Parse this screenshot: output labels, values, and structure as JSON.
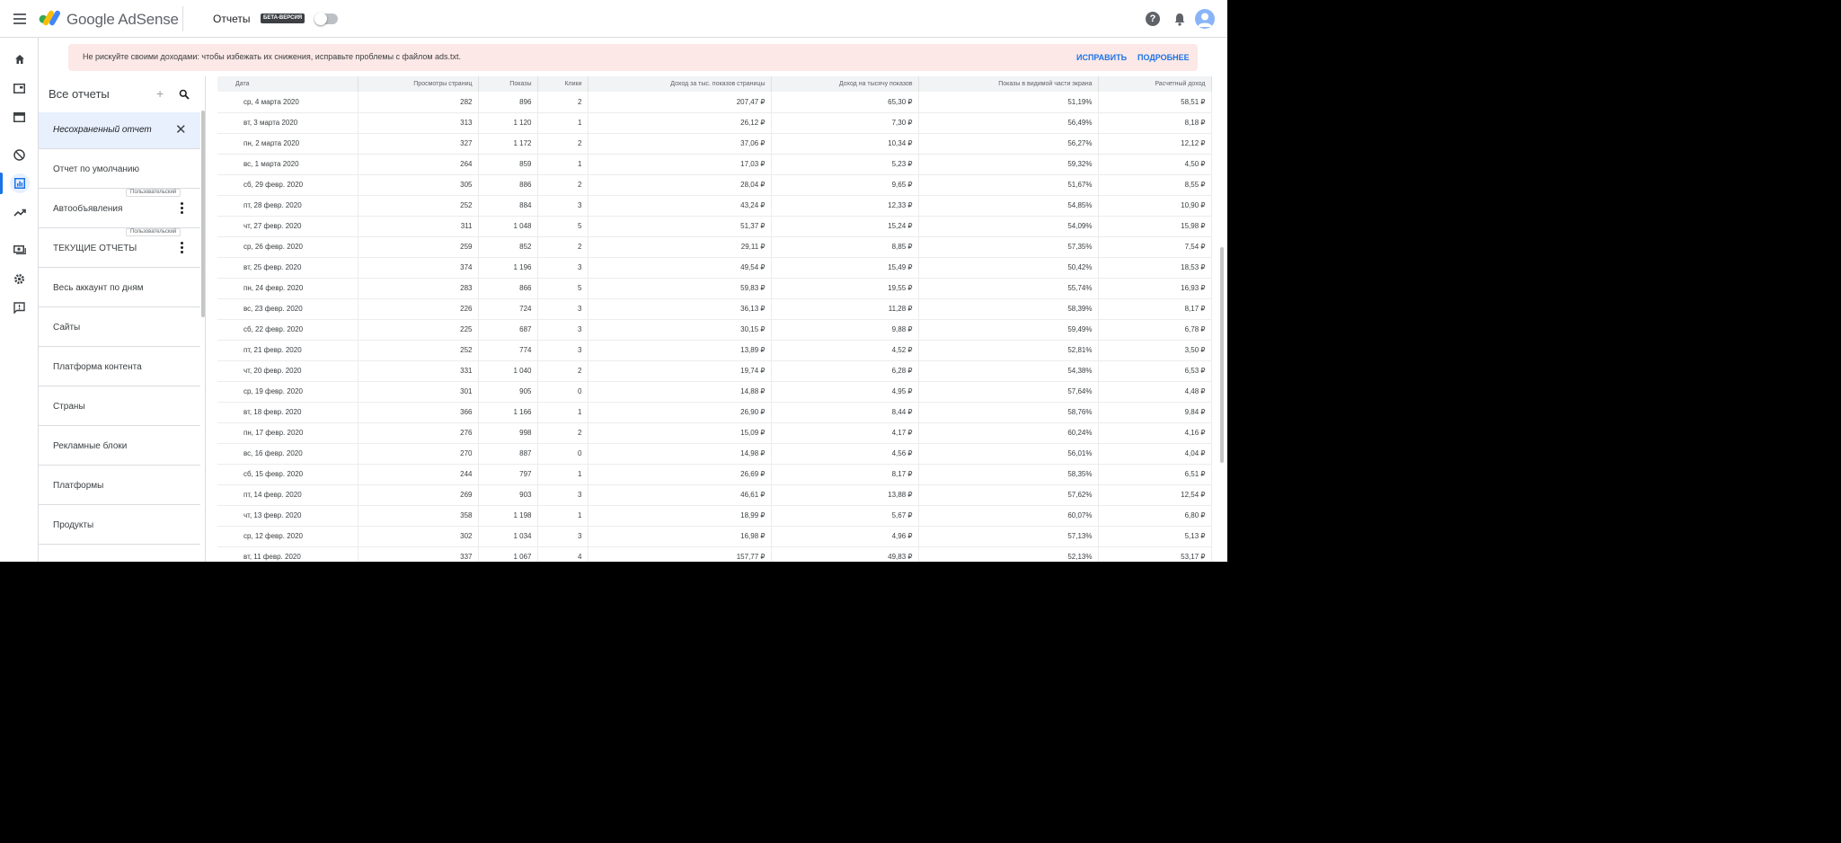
{
  "header": {
    "brand": "Google AdSense",
    "section_title": "Отчеты",
    "beta_badge": "БЕТА-ВЕРСИЯ",
    "help_icon": "help-circle-icon",
    "bell_icon": "bell-icon"
  },
  "rail": {
    "icons": [
      "home-icon",
      "ads-icon",
      "sites-icon",
      "block-icon",
      "reports-icon",
      "optimization-icon",
      "payments-icon",
      "settings-icon",
      "feedback-icon"
    ],
    "active": "reports-icon"
  },
  "banner": {
    "text": "Не рискуйте своими доходами: чтобы избежать их снижения, исправьте проблемы с файлом ads.txt.",
    "fix_label": "ИСПРАВИТЬ",
    "more_label": "ПОДРОБНЕЕ"
  },
  "sidebar": {
    "title": "Все отчеты",
    "add_icon": "plus-icon",
    "search_icon": "search-icon",
    "items": [
      {
        "label": "Несохраненный отчет"
      },
      {
        "label": "Отчет по умолчанию"
      },
      {
        "label": "Автообъявления",
        "tag": "Пользовательский"
      },
      {
        "label": "ТЕКУЩИЕ ОТЧЕТЫ",
        "tag": "Пользовательский"
      },
      {
        "label": "Весь аккаунт по дням"
      },
      {
        "label": "Сайты"
      },
      {
        "label": "Платформа контента"
      },
      {
        "label": "Страны"
      },
      {
        "label": "Рекламные блоки"
      },
      {
        "label": "Платформы"
      },
      {
        "label": "Продукты"
      }
    ]
  },
  "table": {
    "columns": [
      "Дата",
      "Просмотры страниц",
      "Показы",
      "Клики",
      "Доход за тыс. показов страницы",
      "Доход на тысячу показов",
      "Показы в видимой части экрана",
      "Расчетный доход"
    ],
    "rows": [
      [
        "ср, 4 марта 2020",
        "282",
        "896",
        "2",
        "207,47 ₽",
        "65,30 ₽",
        "51,19%",
        "58,51 ₽"
      ],
      [
        "вт, 3 марта 2020",
        "313",
        "1 120",
        "1",
        "26,12 ₽",
        "7,30 ₽",
        "56,49%",
        "8,18 ₽"
      ],
      [
        "пн, 2 марта 2020",
        "327",
        "1 172",
        "2",
        "37,06 ₽",
        "10,34 ₽",
        "56,27%",
        "12,12 ₽"
      ],
      [
        "вс, 1 марта 2020",
        "264",
        "859",
        "1",
        "17,03 ₽",
        "5,23 ₽",
        "59,32%",
        "4,50 ₽"
      ],
      [
        "сб, 29 февр. 2020",
        "305",
        "886",
        "2",
        "28,04 ₽",
        "9,65 ₽",
        "51,67%",
        "8,55 ₽"
      ],
      [
        "пт, 28 февр. 2020",
        "252",
        "884",
        "3",
        "43,24 ₽",
        "12,33 ₽",
        "54,85%",
        "10,90 ₽"
      ],
      [
        "чт, 27 февр. 2020",
        "311",
        "1 048",
        "5",
        "51,37 ₽",
        "15,24 ₽",
        "54,09%",
        "15,98 ₽"
      ],
      [
        "ср, 26 февр. 2020",
        "259",
        "852",
        "2",
        "29,11 ₽",
        "8,85 ₽",
        "57,35%",
        "7,54 ₽"
      ],
      [
        "вт, 25 февр. 2020",
        "374",
        "1 196",
        "3",
        "49,54 ₽",
        "15,49 ₽",
        "50,42%",
        "18,53 ₽"
      ],
      [
        "пн, 24 февр. 2020",
        "283",
        "866",
        "5",
        "59,83 ₽",
        "19,55 ₽",
        "55,74%",
        "16,93 ₽"
      ],
      [
        "вс, 23 февр. 2020",
        "226",
        "724",
        "3",
        "36,13 ₽",
        "11,28 ₽",
        "58,39%",
        "8,17 ₽"
      ],
      [
        "сб, 22 февр. 2020",
        "225",
        "687",
        "3",
        "30,15 ₽",
        "9,88 ₽",
        "59,49%",
        "6,78 ₽"
      ],
      [
        "пт, 21 февр. 2020",
        "252",
        "774",
        "3",
        "13,89 ₽",
        "4,52 ₽",
        "52,81%",
        "3,50 ₽"
      ],
      [
        "чт, 20 февр. 2020",
        "331",
        "1 040",
        "2",
        "19,74 ₽",
        "6,28 ₽",
        "54,38%",
        "6,53 ₽"
      ],
      [
        "ср, 19 февр. 2020",
        "301",
        "905",
        "0",
        "14,88 ₽",
        "4,95 ₽",
        "57,64%",
        "4,48 ₽"
      ],
      [
        "вт, 18 февр. 2020",
        "366",
        "1 166",
        "1",
        "26,90 ₽",
        "8,44 ₽",
        "58,76%",
        "9,84 ₽"
      ],
      [
        "пн, 17 февр. 2020",
        "276",
        "998",
        "2",
        "15,09 ₽",
        "4,17 ₽",
        "60,24%",
        "4,16 ₽"
      ],
      [
        "вс, 16 февр. 2020",
        "270",
        "887",
        "0",
        "14,98 ₽",
        "4,56 ₽",
        "56,01%",
        "4,04 ₽"
      ],
      [
        "сб, 15 февр. 2020",
        "244",
        "797",
        "1",
        "26,69 ₽",
        "8,17 ₽",
        "58,35%",
        "6,51 ₽"
      ],
      [
        "пт, 14 февр. 2020",
        "269",
        "903",
        "3",
        "46,61 ₽",
        "13,88 ₽",
        "57,62%",
        "12,54 ₽"
      ],
      [
        "чт, 13 февр. 2020",
        "358",
        "1 198",
        "1",
        "18,99 ₽",
        "5,67 ₽",
        "60,07%",
        "6,80 ₽"
      ],
      [
        "ср, 12 февр. 2020",
        "302",
        "1 034",
        "3",
        "16,98 ₽",
        "4,96 ₽",
        "57,13%",
        "5,13 ₽"
      ],
      [
        "вт, 11 февр. 2020",
        "337",
        "1 067",
        "4",
        "157,77 ₽",
        "49,83 ₽",
        "52,13%",
        "53,17 ₽"
      ]
    ]
  }
}
